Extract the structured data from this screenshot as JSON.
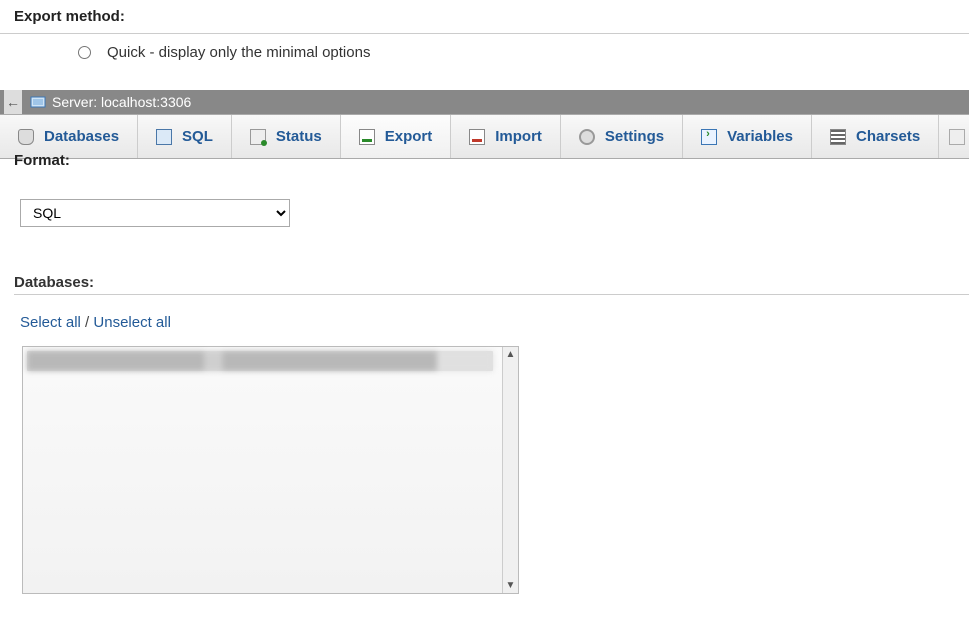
{
  "export_method": {
    "heading": "Export method:",
    "quick_label": "Quick - display only the minimal options"
  },
  "server": {
    "back_glyph": "←",
    "label": "Server: localhost:3306"
  },
  "tabs": {
    "databases": "Databases",
    "sql": "SQL",
    "status": "Status",
    "export": "Export",
    "import": "Import",
    "settings": "Settings",
    "variables": "Variables",
    "charsets": "Charsets"
  },
  "format": {
    "heading": "Format:",
    "selected": "SQL"
  },
  "databases": {
    "heading": "Databases:",
    "select_all": "Select all",
    "separator": "/",
    "unselect_all": "Unselect all",
    "items": [
      "(database name obscured)"
    ]
  }
}
